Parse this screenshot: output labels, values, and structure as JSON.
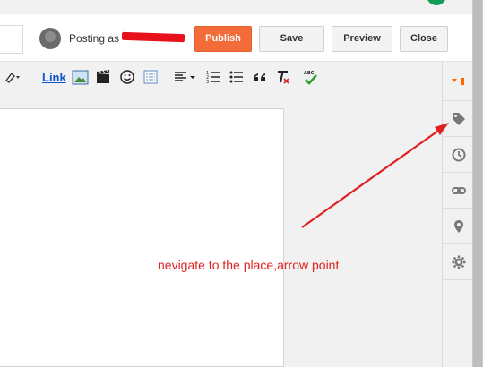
{
  "header": {
    "posting_as_label": "Posting as",
    "publish_label": "Publish",
    "save_label": "Save",
    "preview_label": "Preview",
    "close_label": "Close"
  },
  "toolbar": {
    "link_label": "Link",
    "spellcheck_label": "ABC"
  },
  "sidebar": {
    "items": [
      {
        "name": "labels",
        "icon": "tag-icon"
      },
      {
        "name": "schedule",
        "icon": "clock-icon"
      },
      {
        "name": "permalink",
        "icon": "link-icon"
      },
      {
        "name": "location",
        "icon": "location-pin-icon"
      },
      {
        "name": "options",
        "icon": "gear-icon"
      }
    ]
  },
  "annotation": {
    "text": "nevigate to the place,arrow point",
    "color": "#dd2222"
  },
  "colors": {
    "publish": "#f26b38",
    "accent_orange": "#ff6600"
  }
}
